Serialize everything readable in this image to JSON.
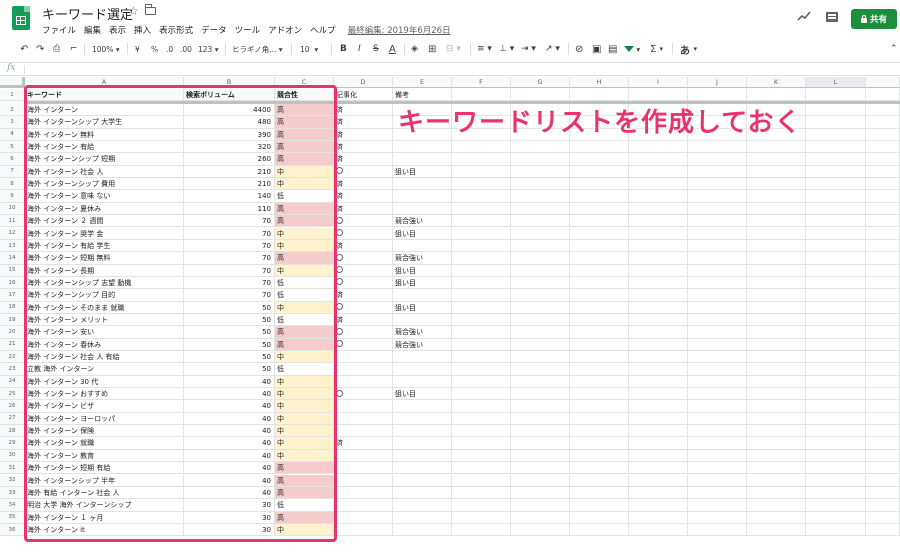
{
  "header": {
    "title": "キーワード選定",
    "menu": [
      "ファイル",
      "編集",
      "表示",
      "挿入",
      "表示形式",
      "データ",
      "ツール",
      "アドオン",
      "ヘルプ"
    ],
    "last_edit": "最終編集: 2019年6月26日",
    "share_label": "共有"
  },
  "toolbar": {
    "zoom": "100%",
    "currency": "¥",
    "percent": "%",
    "dec_decrease": ".0",
    "dec_increase": ".00",
    "more_formats": "123",
    "font": "ヒラギノ角...",
    "font_size": "10",
    "bold": "B",
    "italic": "I",
    "strike": "S",
    "text_color": "A",
    "function": "Σ",
    "input_tools": "あ"
  },
  "formula_bar": {
    "fx": "fx"
  },
  "columns": [
    "A",
    "B",
    "C",
    "D",
    "E",
    "F",
    "G",
    "H",
    "I",
    "J",
    "K",
    "L"
  ],
  "selected_column": "L",
  "table": {
    "headers": {
      "keyword": "キーワード",
      "volume": "検索ボリューム",
      "competition": "競合性",
      "article": "記事化",
      "note": "備考"
    },
    "rows": [
      {
        "n": "2",
        "keyword": "海外 インターン",
        "volume": "4400",
        "comp": "高",
        "article": "済",
        "note": ""
      },
      {
        "n": "3",
        "keyword": "海外 インターンシップ 大学生",
        "volume": "480",
        "comp": "高",
        "article": "済",
        "note": ""
      },
      {
        "n": "4",
        "keyword": "海外 インターン 無料",
        "volume": "390",
        "comp": "高",
        "article": "済",
        "note": ""
      },
      {
        "n": "5",
        "keyword": "海外 インターン 有給",
        "volume": "320",
        "comp": "高",
        "article": "済",
        "note": ""
      },
      {
        "n": "6",
        "keyword": "海外 インターンシップ 短期",
        "volume": "260",
        "comp": "高",
        "article": "済",
        "note": ""
      },
      {
        "n": "7",
        "keyword": "海外 インターン 社会 人",
        "volume": "210",
        "comp": "中",
        "article": "○",
        "note": "狙い目"
      },
      {
        "n": "8",
        "keyword": "海外 インターンシップ 費用",
        "volume": "210",
        "comp": "中",
        "article": "済",
        "note": ""
      },
      {
        "n": "9",
        "keyword": "海外 インターン 意味 ない",
        "volume": "140",
        "comp": "低",
        "article": "済",
        "note": ""
      },
      {
        "n": "10",
        "keyword": "海外 インターン 夏休み",
        "volume": "110",
        "comp": "高",
        "article": "済",
        "note": ""
      },
      {
        "n": "11",
        "keyword": "海外 インターン ２ 週間",
        "volume": "70",
        "comp": "高",
        "article": "○",
        "note": "競合強い"
      },
      {
        "n": "12",
        "keyword": "海外 インターン 奨学 金",
        "volume": "70",
        "comp": "中",
        "article": "○",
        "note": "狙い目"
      },
      {
        "n": "13",
        "keyword": "海外 インターン 有給 学生",
        "volume": "70",
        "comp": "中",
        "article": "済",
        "note": ""
      },
      {
        "n": "14",
        "keyword": "海外 インターン 短期 無料",
        "volume": "70",
        "comp": "高",
        "article": "○",
        "note": "競合強い"
      },
      {
        "n": "15",
        "keyword": "海外 インターン 長期",
        "volume": "70",
        "comp": "中",
        "article": "○",
        "note": "狙い目"
      },
      {
        "n": "16",
        "keyword": "海外 インターンシップ 志望 動機",
        "volume": "70",
        "comp": "低",
        "article": "○",
        "note": "狙い目"
      },
      {
        "n": "17",
        "keyword": "海外 インターンシップ 目的",
        "volume": "70",
        "comp": "低",
        "article": "済",
        "note": ""
      },
      {
        "n": "18",
        "keyword": "海外 インターン そのまま 就職",
        "volume": "50",
        "comp": "中",
        "article": "○",
        "note": "狙い目"
      },
      {
        "n": "19",
        "keyword": "海外 インターン メリット",
        "volume": "50",
        "comp": "低",
        "article": "済",
        "note": ""
      },
      {
        "n": "20",
        "keyword": "海外 インターン 安い",
        "volume": "50",
        "comp": "高",
        "article": "○",
        "note": "競合強い"
      },
      {
        "n": "21",
        "keyword": "海外 インターン 春休み",
        "volume": "50",
        "comp": "高",
        "article": "○",
        "note": "競合強い"
      },
      {
        "n": "22",
        "keyword": "海外 インターン 社会 人 有給",
        "volume": "50",
        "comp": "中",
        "article": "",
        "note": ""
      },
      {
        "n": "23",
        "keyword": "立教 海外 インターン",
        "volume": "50",
        "comp": "低",
        "article": "",
        "note": ""
      },
      {
        "n": "24",
        "keyword": "海外 インターン 30 代",
        "volume": "40",
        "comp": "中",
        "article": "",
        "note": ""
      },
      {
        "n": "25",
        "keyword": "海外 インターン おすすめ",
        "volume": "40",
        "comp": "中",
        "article": "○",
        "note": "狙い目"
      },
      {
        "n": "26",
        "keyword": "海外 インターン ビザ",
        "volume": "40",
        "comp": "中",
        "article": "",
        "note": ""
      },
      {
        "n": "27",
        "keyword": "海外 インターン ヨーロッパ",
        "volume": "40",
        "comp": "中",
        "article": "",
        "note": ""
      },
      {
        "n": "28",
        "keyword": "海外 インターン 保険",
        "volume": "40",
        "comp": "中",
        "article": "",
        "note": ""
      },
      {
        "n": "29",
        "keyword": "海外 インターン 就職",
        "volume": "40",
        "comp": "中",
        "article": "済",
        "note": ""
      },
      {
        "n": "30",
        "keyword": "海外 インターン 教育",
        "volume": "40",
        "comp": "中",
        "article": "",
        "note": ""
      },
      {
        "n": "31",
        "keyword": "海外 インターン 短期 有給",
        "volume": "40",
        "comp": "高",
        "article": "",
        "note": ""
      },
      {
        "n": "32",
        "keyword": "海外 インターンシップ 半年",
        "volume": "40",
        "comp": "高",
        "article": "",
        "note": ""
      },
      {
        "n": "33",
        "keyword": "海外 有給 インターン 社会 人",
        "volume": "40",
        "comp": "高",
        "article": "",
        "note": ""
      },
      {
        "n": "34",
        "keyword": "明治 大学 海外 インターンシップ",
        "volume": "30",
        "comp": "低",
        "article": "",
        "note": ""
      },
      {
        "n": "35",
        "keyword": "海外 インターン １ ヶ月",
        "volume": "30",
        "comp": "高",
        "article": "",
        "note": ""
      },
      {
        "n": "36",
        "keyword": "海外 インターン it",
        "volume": "30",
        "comp": "中",
        "article": "",
        "note": ""
      }
    ]
  },
  "colors": {
    "high": "#f4cccc",
    "mid": "#fff2cc",
    "low": "#ffffff",
    "accent": "#e8336d",
    "share": "#1e8e3e"
  },
  "annotation": "キーワードリストを作成しておく"
}
